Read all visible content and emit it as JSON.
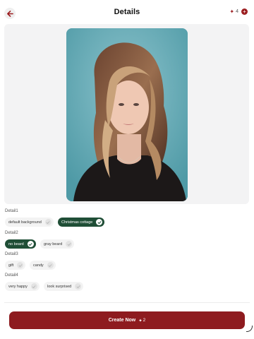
{
  "header": {
    "title": "Details",
    "credits": "4",
    "credits_icon": "sparkle-icon",
    "add_icon": "plus-icon",
    "back_icon": "arrow-left-icon"
  },
  "colors": {
    "accent": "#9b1c1f",
    "selected_chip": "#1f4e36",
    "button": "#8e1b1f"
  },
  "sections": [
    {
      "label": "Detail1",
      "options": [
        {
          "label": "default background",
          "selected": false
        },
        {
          "label": "Christmas cottage",
          "selected": true
        }
      ]
    },
    {
      "label": "Detail2",
      "options": [
        {
          "label": "no beard",
          "selected": true
        },
        {
          "label": "gray beard",
          "selected": false
        }
      ]
    },
    {
      "label": "Detail3",
      "options": [
        {
          "label": "gift",
          "selected": false
        },
        {
          "label": "candy",
          "selected": false
        }
      ]
    },
    {
      "label": "Detail4",
      "options": [
        {
          "label": "very happy",
          "selected": false
        },
        {
          "label": "look surprised",
          "selected": false
        }
      ]
    }
  ],
  "create_button": {
    "label": "Create Now",
    "cost": "2",
    "cost_icon": "sparkle-icon"
  }
}
